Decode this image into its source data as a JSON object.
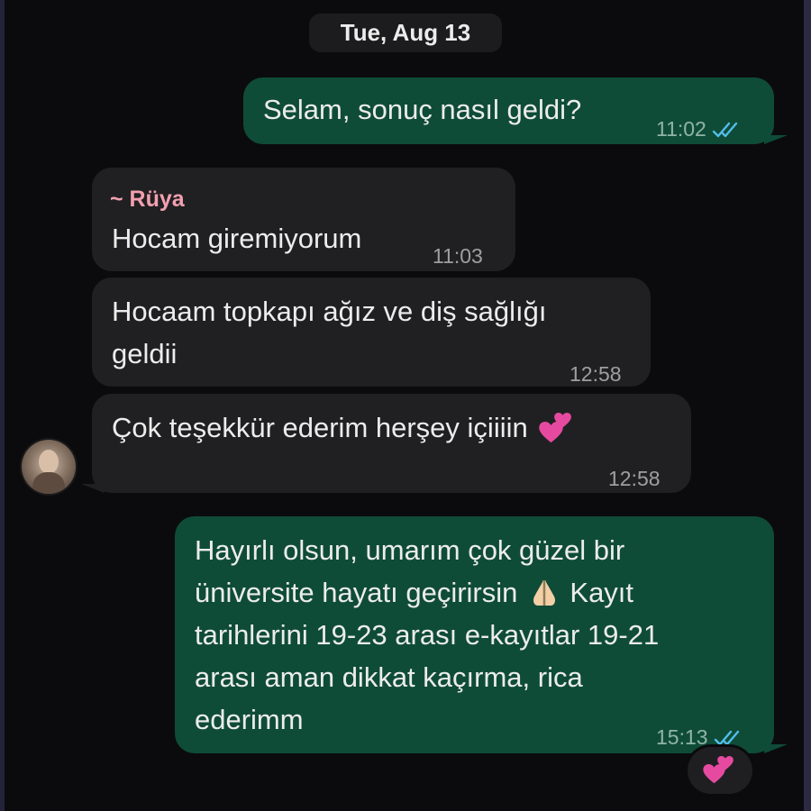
{
  "chat": {
    "date_separator": "Tue, Aug 13",
    "messages": [
      {
        "direction": "outgoing",
        "text": "Selam, sonuç nasıl geldi?",
        "time": "11:02",
        "status": "read-double-check"
      },
      {
        "direction": "incoming",
        "sender": "~ Rüya",
        "text": "Hocam giremiyorum",
        "time": "11:03"
      },
      {
        "direction": "incoming",
        "lines": [
          "Hocaam topkapı ağız ve diş sağlığı",
          "geldii"
        ],
        "time": "12:58"
      },
      {
        "direction": "incoming",
        "text": "Çok teşekkür ederim herşey içiiiin",
        "emoji_icon": "two-hearts-icon",
        "time": "12:58"
      },
      {
        "direction": "outgoing",
        "lines": [
          "Hayırlı olsun, umarım çok güzel bir",
          "üniversite hayatı geçirirsin",
          "Kayıt",
          "tarihlerini 19-23 arası e-kayıtlar 19-21",
          "arası aman dikkat kaçırma, rica",
          "ederimm"
        ],
        "inline_emoji_icon": "folded-hands-icon",
        "time": "15:13",
        "status": "read-double-check",
        "reaction_icon": "two-hearts-icon"
      }
    ]
  },
  "colors": {
    "background": "#0b0b0d",
    "outgoing_bubble": "#0f4c37",
    "incoming_bubble": "#202022",
    "sender_name": "#f2a0b0",
    "read_check": "#53bdeb",
    "heart": "#e64aa0"
  }
}
